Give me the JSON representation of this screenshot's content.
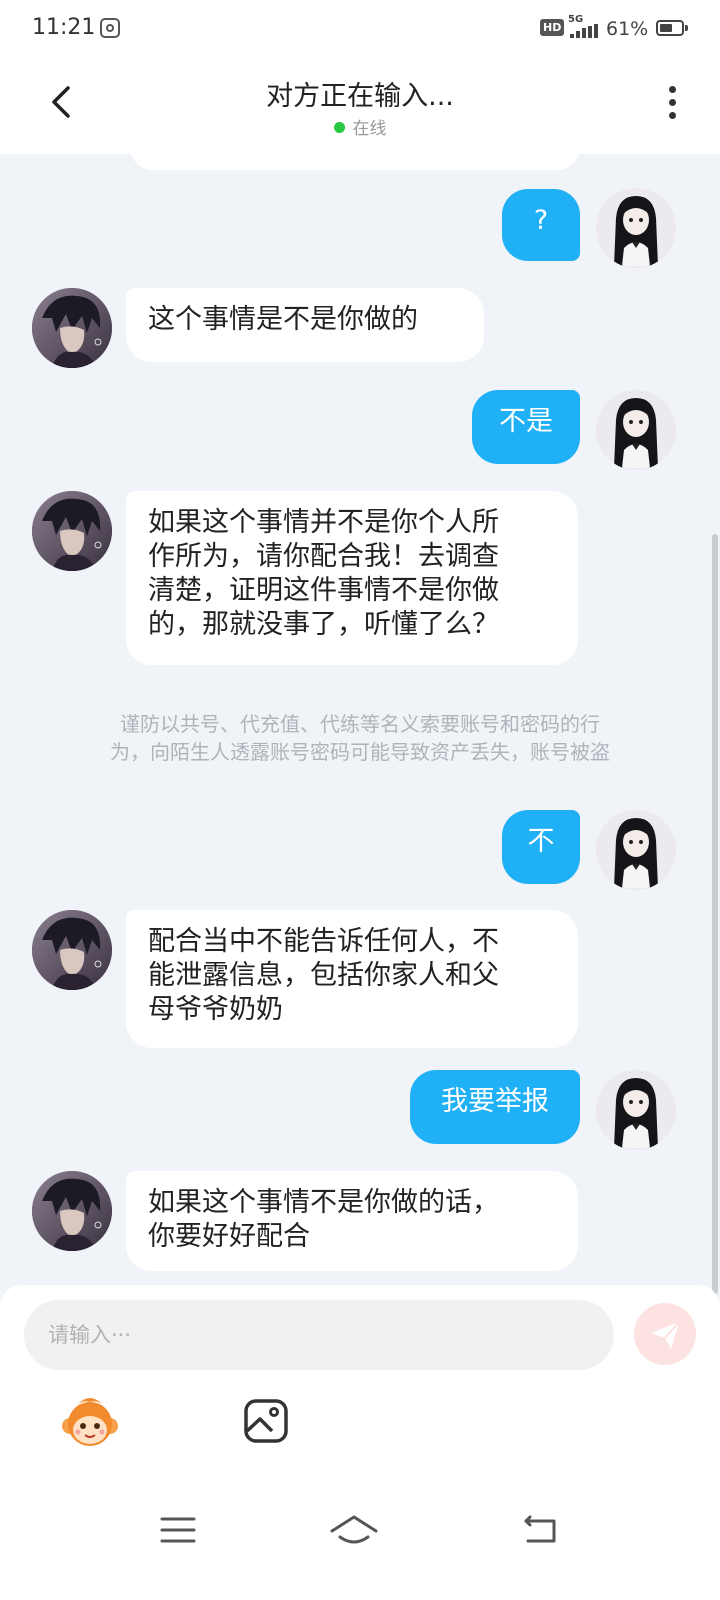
{
  "status_bar": {
    "time": "11:21",
    "hd_label": "HD",
    "network": "5G",
    "battery_percent": "61%",
    "battery_level": 0.61
  },
  "header": {
    "title": "对方正在输入...",
    "status": "在线"
  },
  "messages": [
    {
      "side": "right",
      "text": "?"
    },
    {
      "side": "left",
      "text": "这个事情是不是你做的"
    },
    {
      "side": "right",
      "text": "不是"
    },
    {
      "side": "left",
      "lines": [
        "如果这个事情并不是你个人所",
        "作所为，请你配合我！去调查",
        "清楚，证明这件事情不是你做",
        "的，那就没事了，听懂了么？"
      ]
    },
    {
      "side": "right",
      "text": "不"
    },
    {
      "side": "left",
      "lines": [
        "配合当中不能告诉任何人，不",
        "能泄露信息，包括你家人和父",
        "母爷爷奶奶"
      ]
    },
    {
      "side": "right",
      "text": "我要举报"
    },
    {
      "side": "left",
      "lines": [
        "如果这个事情不是你做的话，",
        "你要好好配合"
      ]
    }
  ],
  "notice": {
    "lines": [
      "谨防以共号、代充值、代练等名义索要账号和密码的行",
      "为，向陌生人透露账号密码可能导致资产丢失，账号被盗"
    ]
  },
  "input": {
    "placeholder": "请输入···"
  },
  "colors": {
    "accent": "#20b0f5",
    "background": "#f0f3f7",
    "online": "#28c840",
    "send_disabled": "#fde2e2"
  },
  "icons": {
    "back": "chevron-left-icon",
    "more": "more-vertical-icon",
    "send": "paper-plane-icon",
    "emoji": "monkey-emoji-icon",
    "image": "image-icon",
    "nav_menu": "menu-icon",
    "nav_home": "home-icon",
    "nav_back": "return-icon"
  }
}
